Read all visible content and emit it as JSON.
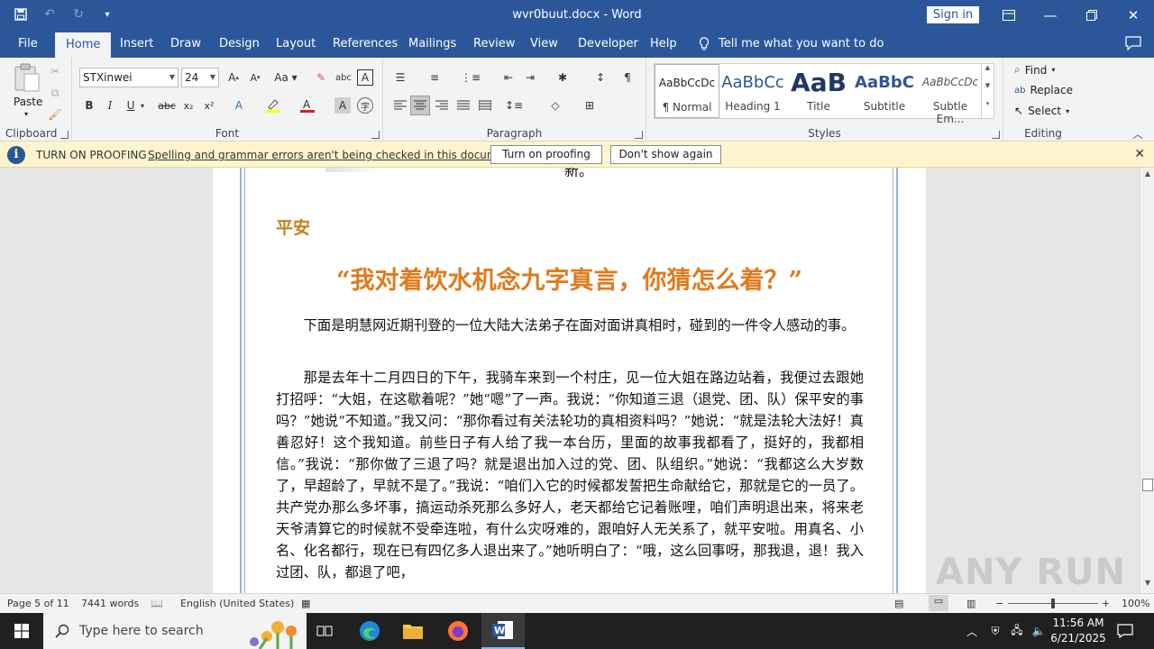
{
  "window": {
    "title": "wvr0buut.docx - Word",
    "sign_in": "Sign in"
  },
  "tabs": [
    "File",
    "Home",
    "Insert",
    "Draw",
    "Design",
    "Layout",
    "References",
    "Mailings",
    "Review",
    "View",
    "Developer",
    "Help"
  ],
  "active_tab": "Home",
  "tell_me": "Tell me what you want to do",
  "ribbon": {
    "clipboard": {
      "paste": "Paste",
      "label": "Clipboard"
    },
    "font": {
      "name": "STXinwei",
      "size": "24",
      "label": "Font",
      "font_color": "#e01b1b",
      "highlight_color": "#ffff00"
    },
    "paragraph": {
      "label": "Paragraph"
    },
    "styles": {
      "label": "Styles",
      "items": [
        {
          "preview": "AaBbCcDc",
          "name": "¶ Normal"
        },
        {
          "preview": "AaBbCc",
          "name": "Heading 1"
        },
        {
          "preview": "AaB",
          "name": "Title"
        },
        {
          "preview": "AaBbC",
          "name": "Subtitle"
        },
        {
          "preview": "AaBbCcDc",
          "name": "Subtle Em..."
        }
      ]
    },
    "editing": {
      "find": "Find",
      "replace": "Replace",
      "select": "Select",
      "label": "Editing"
    }
  },
  "message_bar": {
    "title": "TURN ON PROOFING",
    "text": "Spelling and grammar errors aren't being checked in this document.",
    "btn_on": "Turn on proofing",
    "btn_dismiss": "Don't show again"
  },
  "document": {
    "fragment": "新。",
    "heading_small": "平安",
    "heading_large": "“我对着饮水机念九字真言，你猜怎么着？”",
    "paragraphs": [
      "下面是明慧网近期刊登的一位大陆大法弟子在面对面讲真相时，碰到的一件令人感动的事。",
      "那是去年十二月四日的下午，我骑车来到一个村庄，见一位大姐在路边站着，我便过去跟她打招呼：“大姐，在这歇着呢？”她“嗯”了一声。我说：“你知道三退（退党、团、队）保平安的事吗？”她说“不知道。”我又问：“那你看过有关法轮功的真相资料吗？”她说：“就是法轮大法好！真善忍好！这个我知道。前些日子有人给了我一本台历，里面的故事我都看了，挺好的，我都相信。”我说：“那你做了三退了吗？就是退出加入过的党、团、队组织。”她说：“我都这么大岁数了，早超龄了，早就不是了。”我说：“咱们入它的时候都发誓把生命献给它，那就是它的一员了。共产党办那么多坏事，搞运动杀死那么多好人，老天都给它记着账哩，咱们声明退出来，将来老天爷清算它的时候就不受牵连啦，有什么灾呀难的，跟咱好人无关系了，就平安啦。用真名、小名、化名都行，现在已有四亿多人退出来了。”她听明白了：“哦，这么回事呀，那我退，退！我入过团、队，都退了吧，"
    ]
  },
  "status": {
    "page": "Page 5 of 11",
    "words": "7441 words",
    "language": "English (United States)",
    "zoom": "100%"
  },
  "taskbar": {
    "search_placeholder": "Type here to search",
    "time": "11:56 AM",
    "date": "6/21/2025"
  },
  "watermark": "ANY RUN"
}
